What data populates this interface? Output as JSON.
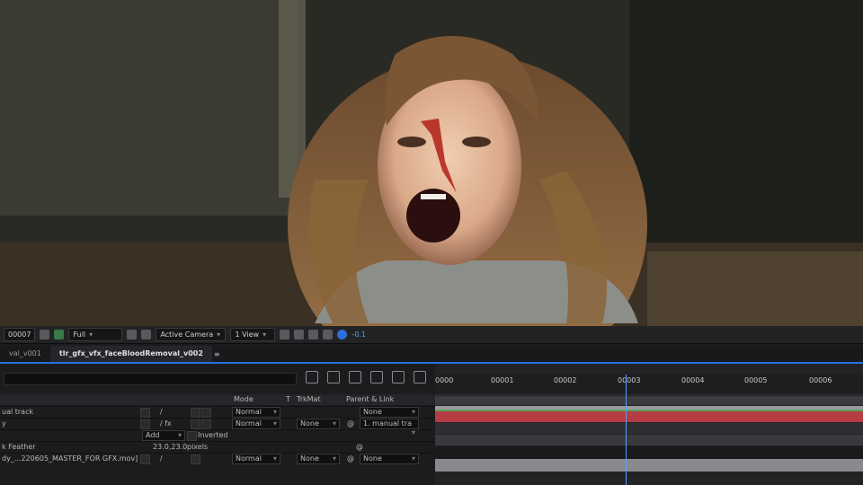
{
  "viewer": {
    "description_icon": "movie-frame"
  },
  "viewer_toolbar": {
    "frame": "00007",
    "resolution": "Full",
    "camera": "Active Camera",
    "views": "1 View",
    "exposure": "-0.1"
  },
  "tabs": [
    {
      "label": "val_v001"
    },
    {
      "label": "tlr_gfx_vfx_faceBloodRemoval_v002"
    }
  ],
  "timeline": {
    "ruler": [
      "0000",
      "00001",
      "00002",
      "00003",
      "00004",
      "00005",
      "00006"
    ]
  },
  "layers": {
    "header": {
      "mode": "Mode",
      "t": "T",
      "trkmat": "TrkMat",
      "parent": "Parent & Link"
    },
    "row1": {
      "name": "ual track",
      "mode": "Normal",
      "parent": "None"
    },
    "row2": {
      "name": "y",
      "mode": "Normal",
      "trkmat": "None",
      "parent": "1. manual tra"
    },
    "row3": {
      "mask_mode": "Add",
      "inverted": "Inverted"
    },
    "row4": {
      "name": "k Feather",
      "value": "23.0,23.0",
      "unit": "pixels"
    },
    "row5": {
      "name": "dy_...220605_MASTER_FOR GFX.mov]",
      "mode": "Normal",
      "trkmat": "None",
      "parent": "None"
    }
  },
  "colors": {
    "accent": "#2c6fe0",
    "red_bar": "#b43c42",
    "green_line": "#5aa05a"
  }
}
